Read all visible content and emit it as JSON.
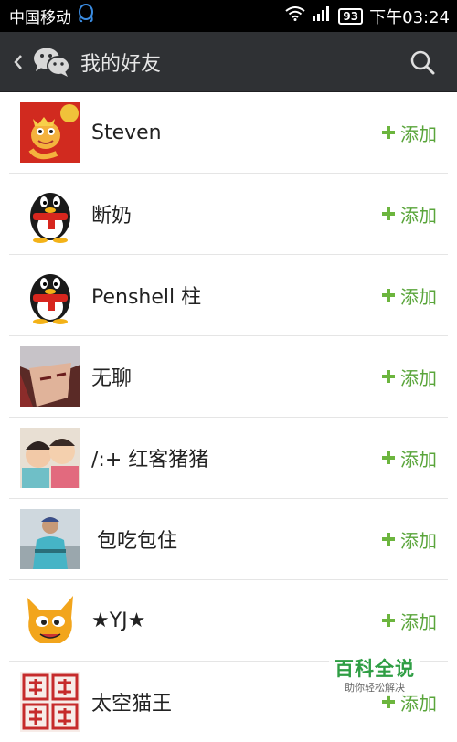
{
  "status_bar": {
    "carrier": "中国移动",
    "battery": "93",
    "time": "下午03:24",
    "icons": [
      "qq-icon",
      "wifi-icon",
      "signal-icon",
      "battery-icon"
    ]
  },
  "header": {
    "title": "我的好友",
    "icons": [
      "back-chevron-icon",
      "wechat-logo-icon",
      "search-icon"
    ]
  },
  "friends": [
    {
      "name": "Steven",
      "add_label": "添加"
    },
    {
      "name": "断奶",
      "add_label": "添加"
    },
    {
      "name": "Penshell 柱",
      "add_label": "添加"
    },
    {
      "name": "无聊",
      "add_label": "添加"
    },
    {
      "name": "/:+ 红客猪猪",
      "add_label": "添加"
    },
    {
      "name": "包吃包住",
      "add_label": "添加"
    },
    {
      "name": "★YJ★",
      "add_label": "添加"
    },
    {
      "name": "太空猫王",
      "add_label": "添加"
    }
  ],
  "watermark": {
    "title": "百科全说",
    "subtitle": "助你轻松解决"
  },
  "colors": {
    "title_bar": "#2f3134",
    "accent_green": "#5aa53b",
    "divider": "#e5e5e5"
  }
}
